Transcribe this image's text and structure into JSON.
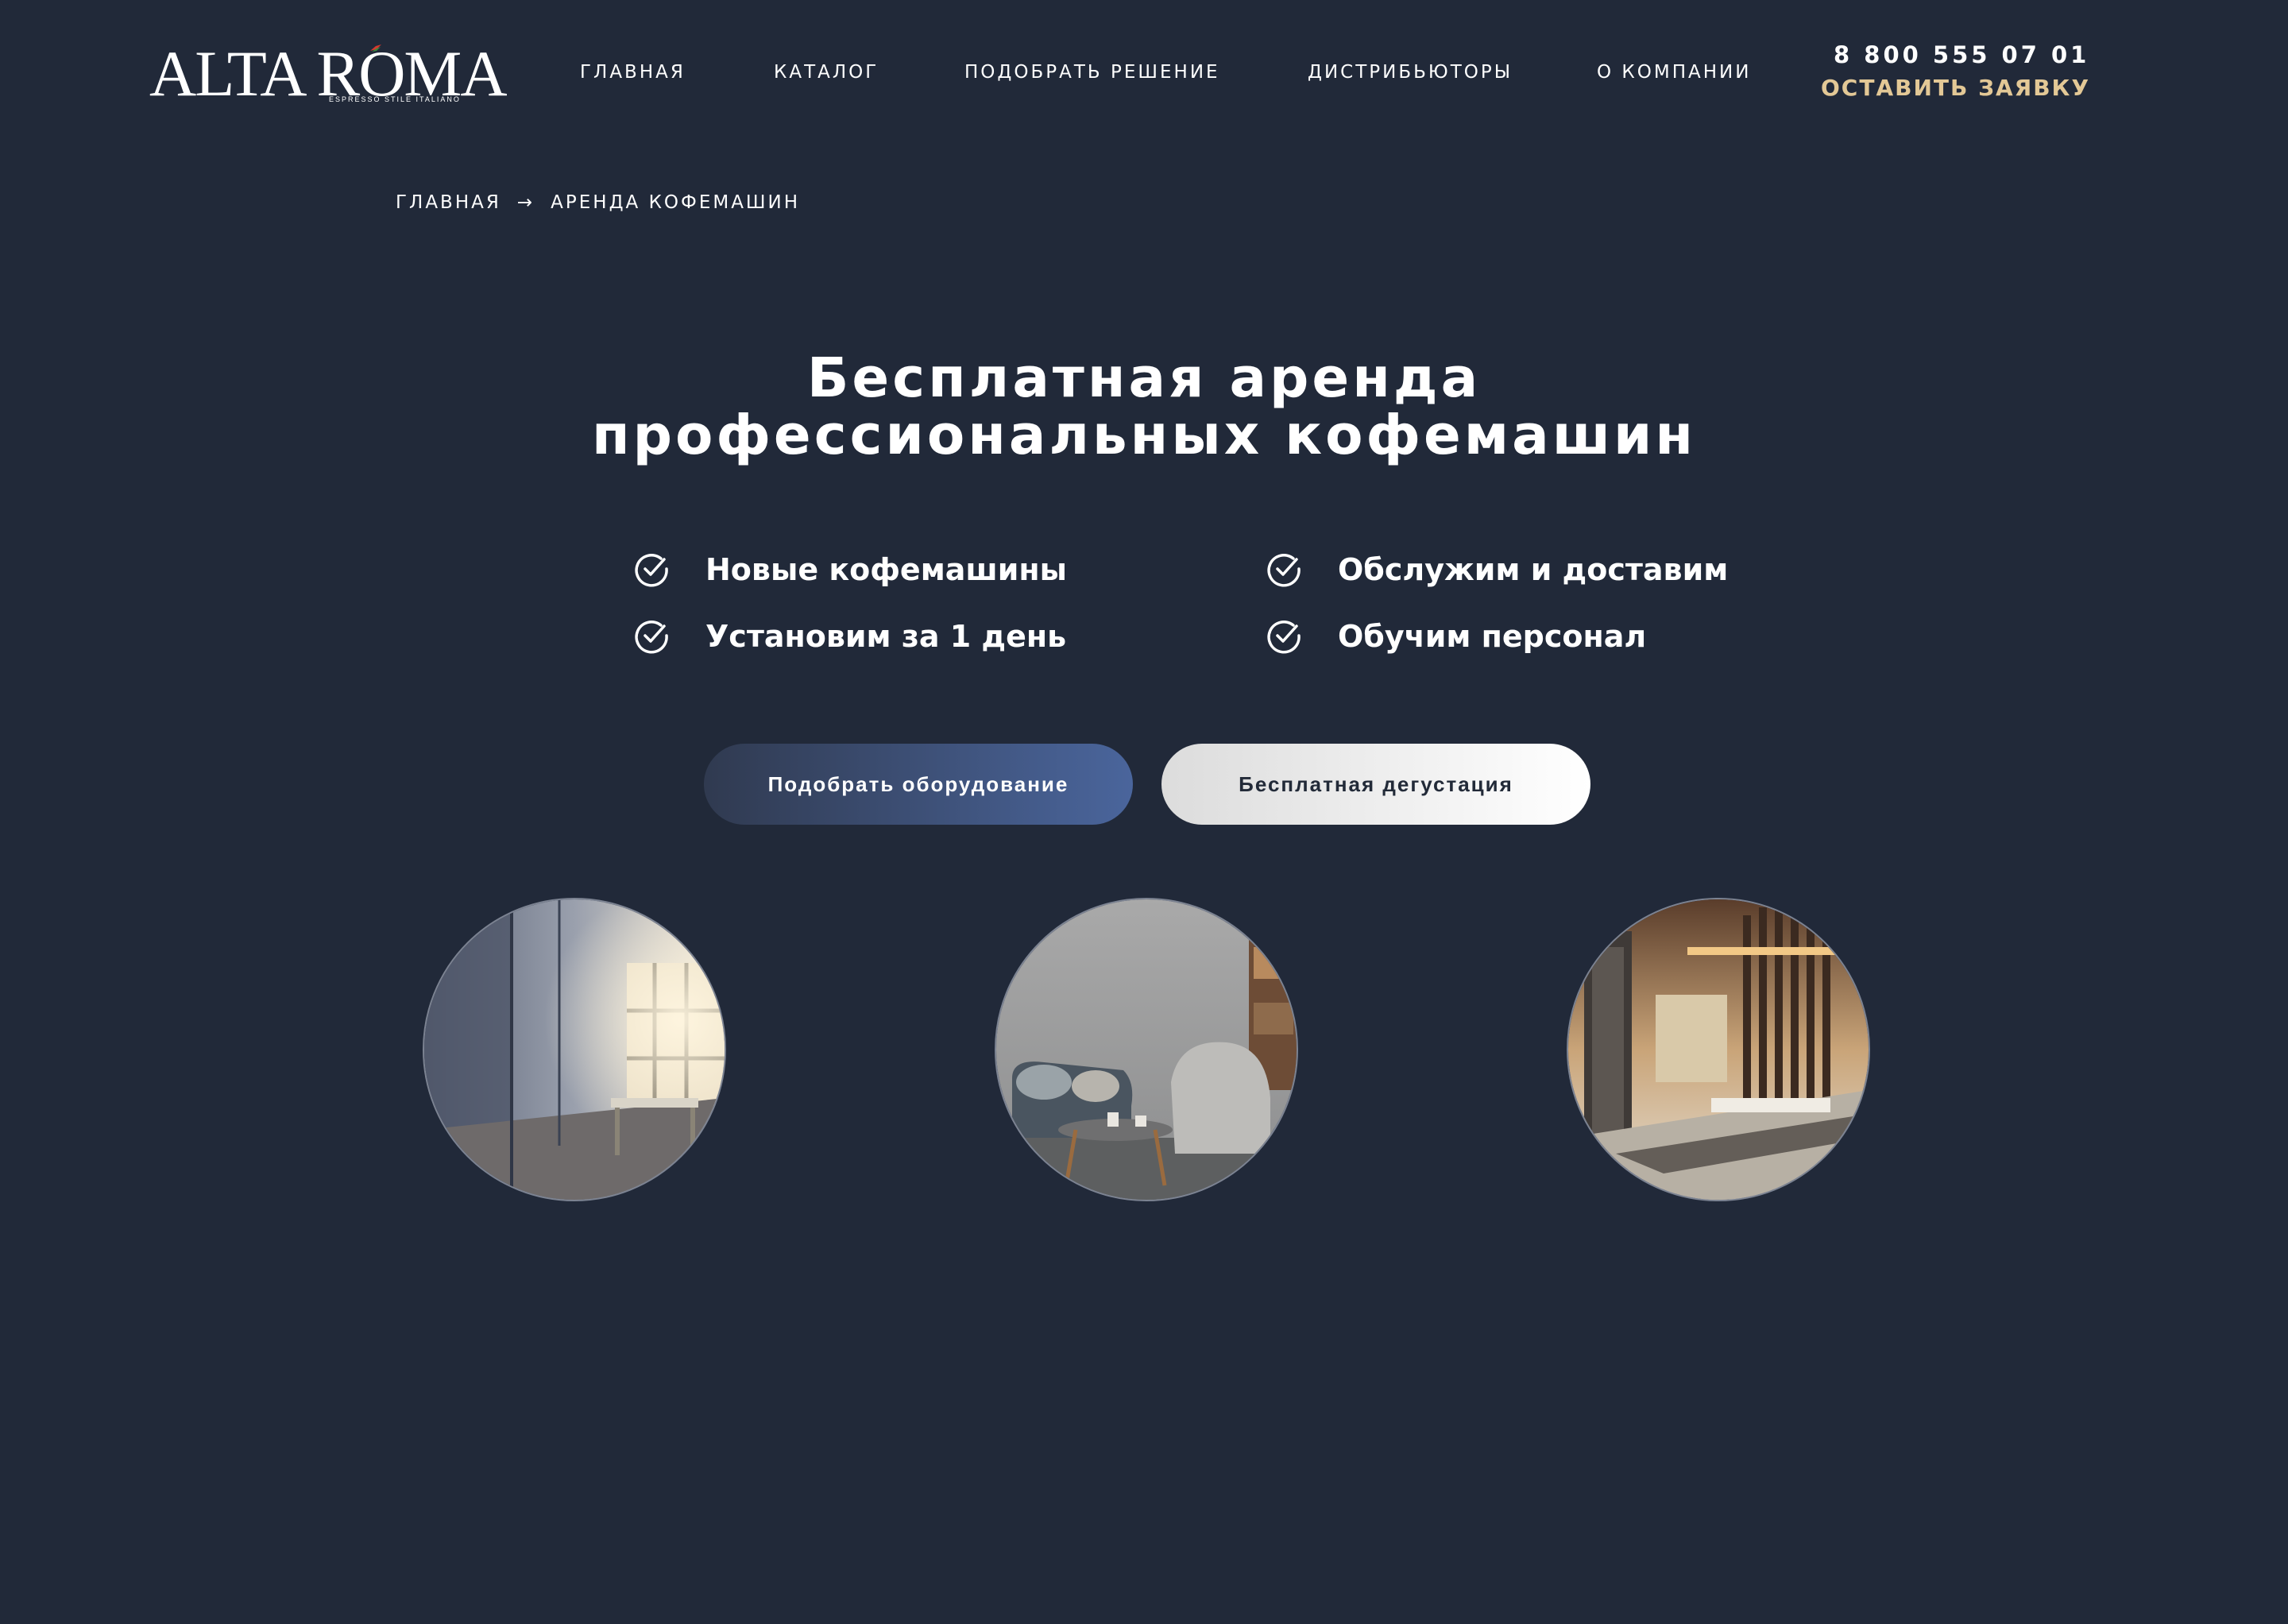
{
  "brand": {
    "logo_text": "ALTA ROMA",
    "tagline": "ESPRESSO  STILE  ITALIANO"
  },
  "nav": {
    "items": [
      {
        "label": "ГЛАВНАЯ"
      },
      {
        "label": "КАТАЛОГ"
      },
      {
        "label": "ПОДОБРАТЬ РЕШЕНИЕ"
      },
      {
        "label": "ДИСТРИБЬЮТОРЫ"
      },
      {
        "label": "О КОМПАНИИ"
      }
    ],
    "phone": "8 800 555 07 01",
    "cta_label": "ОСТАВИТЬ ЗАЯВКУ"
  },
  "breadcrumb": {
    "home": "ГЛАВНАЯ",
    "separator": "→",
    "current": "АРЕНДА КОФЕМАШИН"
  },
  "hero": {
    "title_line1": "Бесплатная аренда",
    "title_line2": "профессиональных кофемашин",
    "features": [
      {
        "label": "Новые кофемашины",
        "icon": "check-circle-icon"
      },
      {
        "label": "Обслужим и доставим",
        "icon": "check-circle-icon"
      },
      {
        "label": "Установим за 1 день",
        "icon": "check-circle-icon"
      },
      {
        "label": "Обучим персонал",
        "icon": "check-circle-icon"
      }
    ],
    "primary_button": "Подобрать оборудование",
    "secondary_button": "Бесплатная дегустация"
  },
  "photos": [
    {
      "subject": "office-interior"
    },
    {
      "subject": "lounge-with-armchairs"
    },
    {
      "subject": "hotel-lobby"
    }
  ],
  "colors": {
    "background": "#212939",
    "accent_gold": "#e3c896",
    "primary_button_start": "#303a50",
    "primary_button_end": "#4a659c",
    "secondary_button": "#f2f2f2"
  }
}
